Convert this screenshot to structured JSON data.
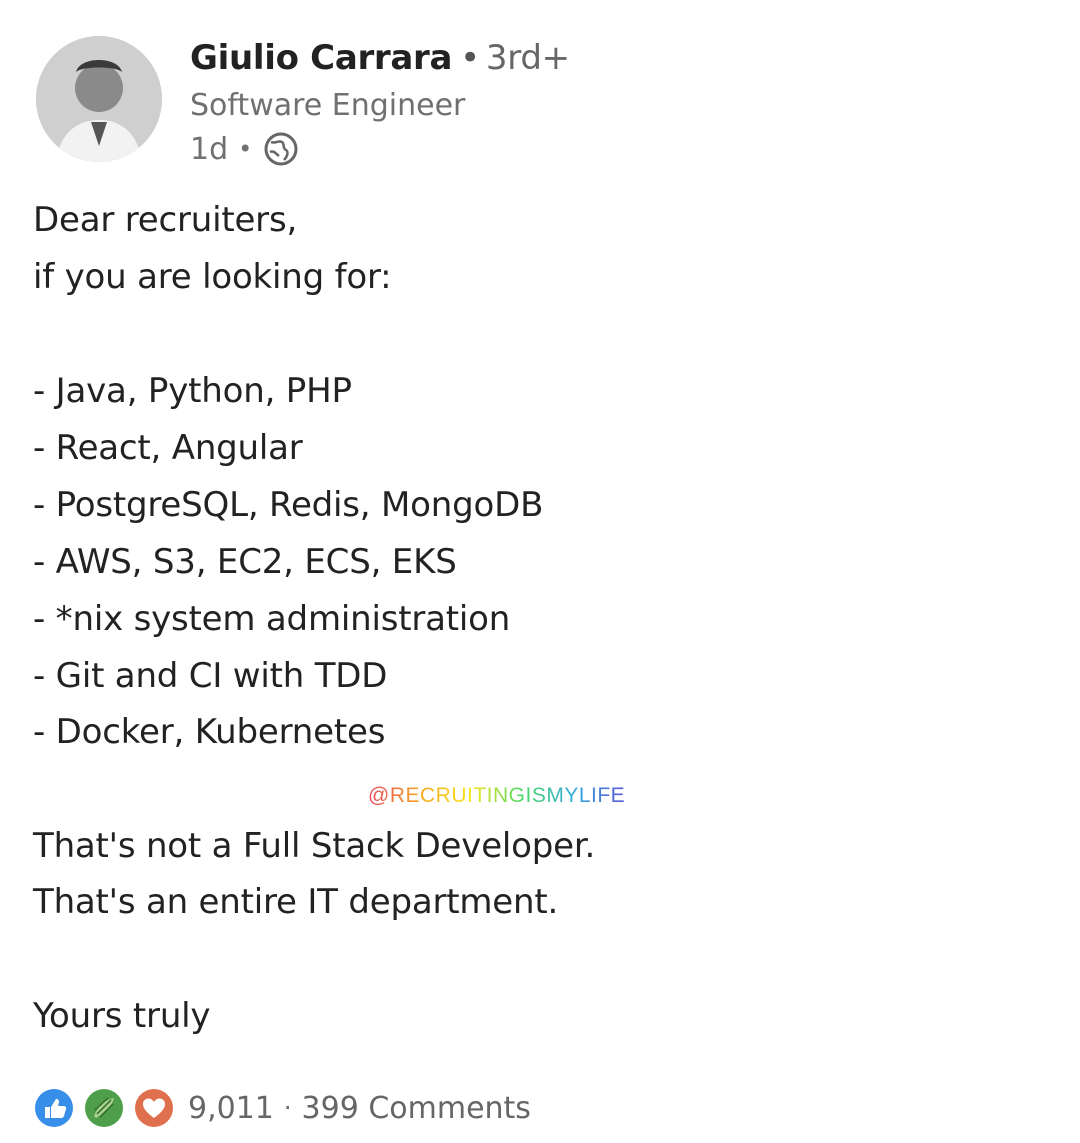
{
  "author": {
    "name": "Giulio Carrara",
    "separator": "•",
    "degree": "3rd+",
    "headline": "Software Engineer",
    "posted_ago": "1d",
    "meta_separator": "•",
    "visibility_icon": "globe-icon"
  },
  "post": {
    "lines": [
      "Dear recruiters,",
      "if you are looking for:",
      "- Java, Python, PHP",
      "- React, Angular",
      "- PostgreSQL, Redis, MongoDB",
      "- AWS, S3, EC2, ECS, EKS",
      "- *nix system administration",
      "- Git and CI with TDD",
      "- Docker, Kubernetes",
      "That's not a Full Stack Developer.",
      "That's an entire IT department.",
      "Yours truly"
    ],
    "watermark": "@RECRUITINGISMYLIFE"
  },
  "social": {
    "reaction_icons": [
      "like-icon",
      "celebrate-icon",
      "love-icon"
    ],
    "reaction_count": "9,011",
    "separator": "·",
    "comments": "399 Comments"
  },
  "colors": {
    "like": "#0a66c2",
    "celebrate": "#3f8a3a",
    "love": "#df704d",
    "text": "#222222",
    "muted": "#707070"
  }
}
